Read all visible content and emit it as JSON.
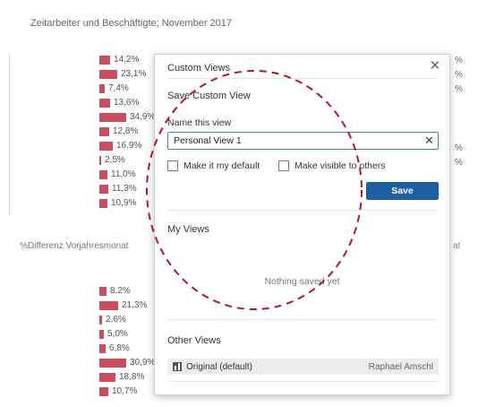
{
  "dashboard": {
    "title": "Zeitarbeiter und Beschäftigte; November 2017",
    "section2_label": "%Differenz Vorjahresmonat",
    "right_hint": "at",
    "top_bars": [
      {
        "label": "14,2%",
        "value": 14.2
      },
      {
        "label": "23,1%",
        "value": 23.1
      },
      {
        "label": "7,4%",
        "value": 7.4
      },
      {
        "label": "13,6%",
        "value": 13.6
      },
      {
        "label": "34,9%",
        "value": 34.9
      },
      {
        "label": "12,8%",
        "value": 12.8
      },
      {
        "label": "16,9%",
        "value": 16.9
      },
      {
        "label": "2,5%",
        "value": 2.5
      },
      {
        "label": "11,0%",
        "value": 11.0
      },
      {
        "label": "11,3%",
        "value": 11.3
      },
      {
        "label": "10,9%",
        "value": 10.9
      }
    ],
    "bottom_bars": [
      {
        "label": "8,2%",
        "value": 8.2
      },
      {
        "label": "21,3%",
        "value": 21.3
      },
      {
        "label": "2,6%",
        "value": 2.6
      },
      {
        "label": "5,0%",
        "value": 5.0
      },
      {
        "label": "6,8%",
        "value": 6.8
      },
      {
        "label": "30,9%",
        "value": 30.9
      },
      {
        "label": "18,8%",
        "value": 18.8
      },
      {
        "label": "10,7%",
        "value": 10.7
      }
    ],
    "right_edge_labels": [
      "%",
      "%",
      "%",
      "%",
      "%"
    ],
    "bar_color": "#c8505e"
  },
  "dialog": {
    "title": "Custom Views",
    "close_icon": "close-icon",
    "save_heading": "Save Custom View",
    "name_label": "Name this view",
    "name_value": "Personal View 1",
    "clear_icon": "clear-icon",
    "default_checkbox_label": "Make it my default",
    "visible_checkbox_label": "Make visible to others",
    "save_button_label": "Save",
    "my_views_heading": "My Views",
    "empty_message": "Nothing saved yet",
    "other_views_heading": "Other Views",
    "other_views": [
      {
        "name": "Original (default)",
        "owner": "Raphael Amschl",
        "icon": "view-icon"
      }
    ],
    "accent_color": "#1f5fa1"
  },
  "annotation": {
    "color": "#b0182a",
    "shape": "dashed-circle"
  }
}
